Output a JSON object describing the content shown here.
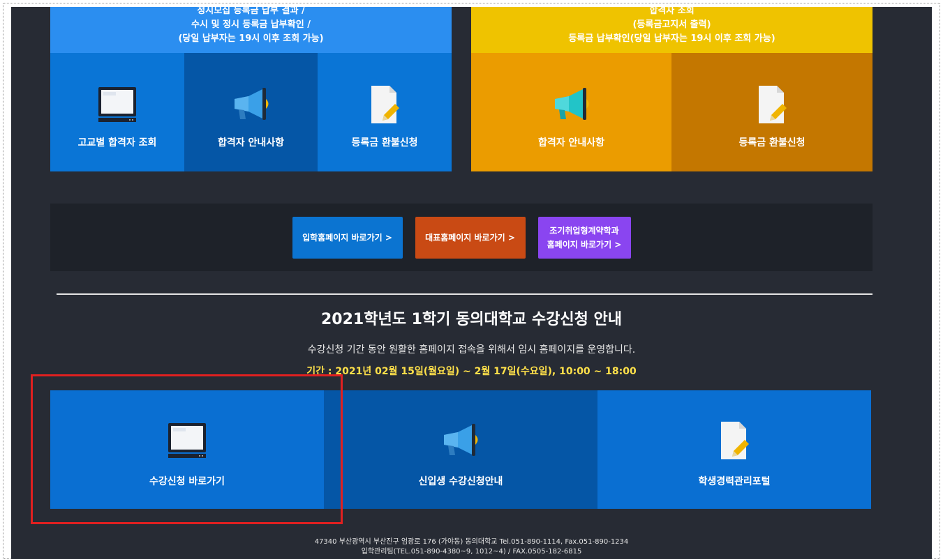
{
  "top_blue_panel": {
    "lines": [
      "정시모집 등록금 납부 결과 /",
      "수시 및 정시 등록금 납부확인 /",
      "(당일 납부자는 19시 이후 조회 가능)"
    ],
    "tiles": [
      {
        "label": "고교별 합격자 조회",
        "icon": "monitor-icon"
      },
      {
        "label": "합격자 안내사항",
        "icon": "megaphone-icon"
      },
      {
        "label": "등록금 환불신청",
        "icon": "document-pencil-icon"
      }
    ]
  },
  "top_yellow_panel": {
    "lines": [
      "합격자 조회",
      "(등록금고지서 출력)",
      "등록금 납부확인(당일 납부자는 19시 이후 조회 가능)"
    ],
    "tiles": [
      {
        "label": "합격자 안내사항",
        "icon": "megaphone-icon"
      },
      {
        "label": "등록금 환불신청",
        "icon": "document-pencil-icon"
      }
    ]
  },
  "links": {
    "admission": "입학홈페이지 바로가기 >",
    "main": "대표홈페이지 바로가기 >",
    "contract_line1": "조기취업형계약학과",
    "contract_line2": "홈페이지 바로가기 >"
  },
  "section": {
    "title": "2021학년도 1학기 동의대학교 수강신청 안내",
    "subtitle": "수강신청 기간 동안 원활한 홈페이지 접속을 위해서 임시 홈페이지를 운영합니다.",
    "period": "기간 : 2021년 02월 15일(월요일) ~ 2월 17일(수요일), 10:00 ~ 18:00"
  },
  "bottom_tiles": [
    {
      "label": "수강신청 바로가기",
      "icon": "monitor-icon"
    },
    {
      "label": "신입생 수강신청안내",
      "icon": "megaphone-icon"
    },
    {
      "label": "학생경력관리포털",
      "icon": "document-pencil-icon"
    }
  ],
  "footer": {
    "line1": "47340 부산광역시 부산진구 엄광로 176 (가야동) 동의대학교 Tel.051-890-1114, Fax.051-890-1234",
    "line2": "입학관리팀(TEL.051-890-4380~9, 1012~4) / FAX.0505-182-6815"
  },
  "colors": {
    "page_bg": "#272b34",
    "blue": "#0a75d6",
    "dark_blue": "#0556a6",
    "yellow": "#efc300",
    "orange": "#eb9c00",
    "highlight": "#e02020"
  }
}
